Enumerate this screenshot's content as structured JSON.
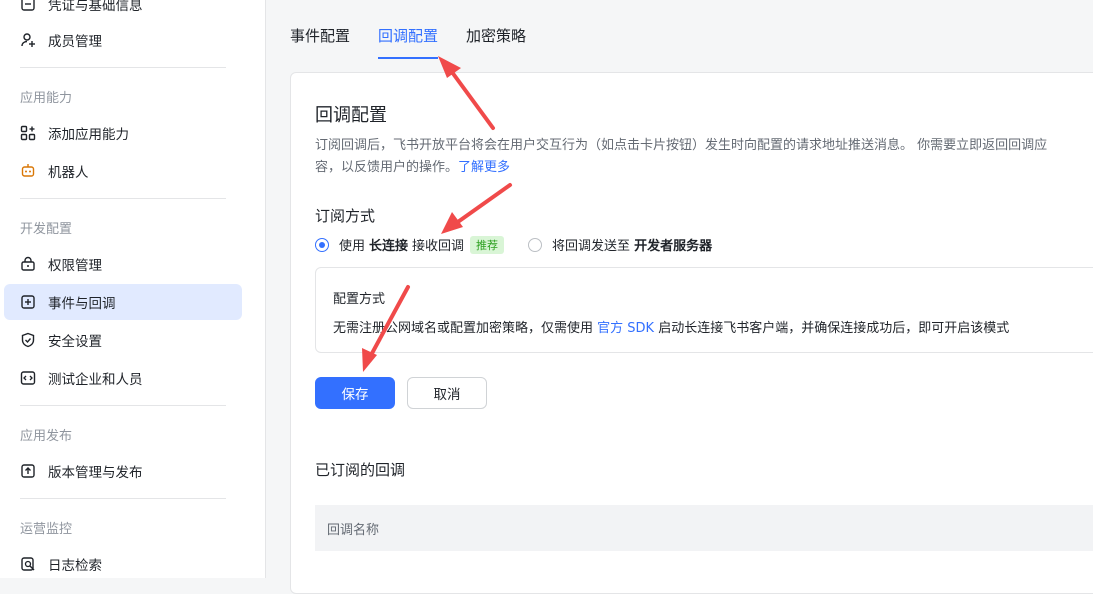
{
  "sidebar": {
    "top_items": [
      {
        "label": "凭证与基础信息",
        "icon": "credential-icon"
      },
      {
        "label": "成员管理",
        "icon": "member-icon"
      }
    ],
    "sections": [
      {
        "title": "应用能力",
        "items": [
          {
            "label": "添加应用能力",
            "icon": "add-capability-icon"
          },
          {
            "label": "机器人",
            "icon": "robot-icon"
          }
        ]
      },
      {
        "title": "开发配置",
        "items": [
          {
            "label": "权限管理",
            "icon": "permission-icon"
          },
          {
            "label": "事件与回调",
            "icon": "event-icon",
            "active": true
          },
          {
            "label": "安全设置",
            "icon": "shield-icon"
          },
          {
            "label": "测试企业和人员",
            "icon": "code-icon"
          }
        ]
      },
      {
        "title": "应用发布",
        "items": [
          {
            "label": "版本管理与发布",
            "icon": "upload-icon"
          }
        ]
      },
      {
        "title": "运营监控",
        "items": [
          {
            "label": "日志检索",
            "icon": "log-search-icon"
          }
        ]
      }
    ]
  },
  "tabs": [
    {
      "label": "事件配置"
    },
    {
      "label": "回调配置",
      "active": true
    },
    {
      "label": "加密策略"
    }
  ],
  "card": {
    "title": "回调配置",
    "desc_line1": "订阅回调后，飞书开放平台将会在用户交互行为（如点击卡片按钮）发生时向配置的请求地址推送消息。 你需要立即返回回调应",
    "desc_line2": "容，以反馈用户的操作。",
    "learn_more": "了解更多",
    "subscribe_title": "订阅方式",
    "option1_prefix": "使用",
    "option1_strong": "长连接",
    "option1_suffix": "接收回调",
    "option1_badge": "推荐",
    "option2_prefix": "将回调发送至",
    "option2_strong": "开发者服务器",
    "config_title": "配置方式",
    "config_text_pre": "无需注册公网域名或配置加密策略，仅需使用",
    "config_link": "官方 SDK",
    "config_text_post": "启动长连接飞书客户端，并确保连接成功后，即可开启该模式",
    "save": "保存",
    "cancel": "取消",
    "subscribed_title": "已订阅的回调",
    "col_name": "回调名称"
  },
  "colors": {
    "accent": "#3370ff",
    "annotation_arrow": "#f04a4a"
  }
}
